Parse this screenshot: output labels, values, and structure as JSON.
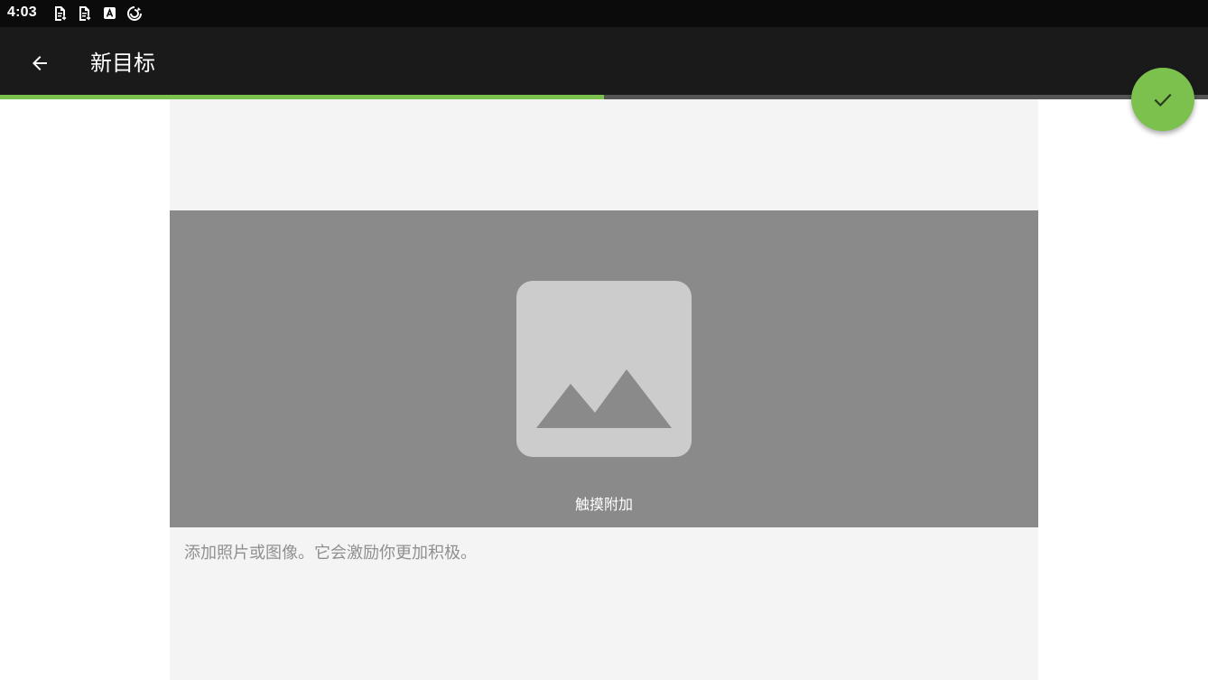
{
  "status_bar": {
    "time": "4:03",
    "icons": [
      "document-download-icon",
      "document-download-icon",
      "text-app-icon",
      "sync-icon"
    ]
  },
  "app_bar": {
    "title": "新目标",
    "back_icon": "arrow-back-icon"
  },
  "progress": {
    "fraction": 0.5,
    "fill_color": "#7cc04e",
    "track_color": "#555555"
  },
  "image_picker": {
    "icon": "image-placeholder-icon",
    "label": "触摸附加"
  },
  "hint": {
    "text": "添加照片或图像。它会激励你更加积极。"
  },
  "fab": {
    "icon": "check-icon",
    "color": "#7cc04e"
  }
}
